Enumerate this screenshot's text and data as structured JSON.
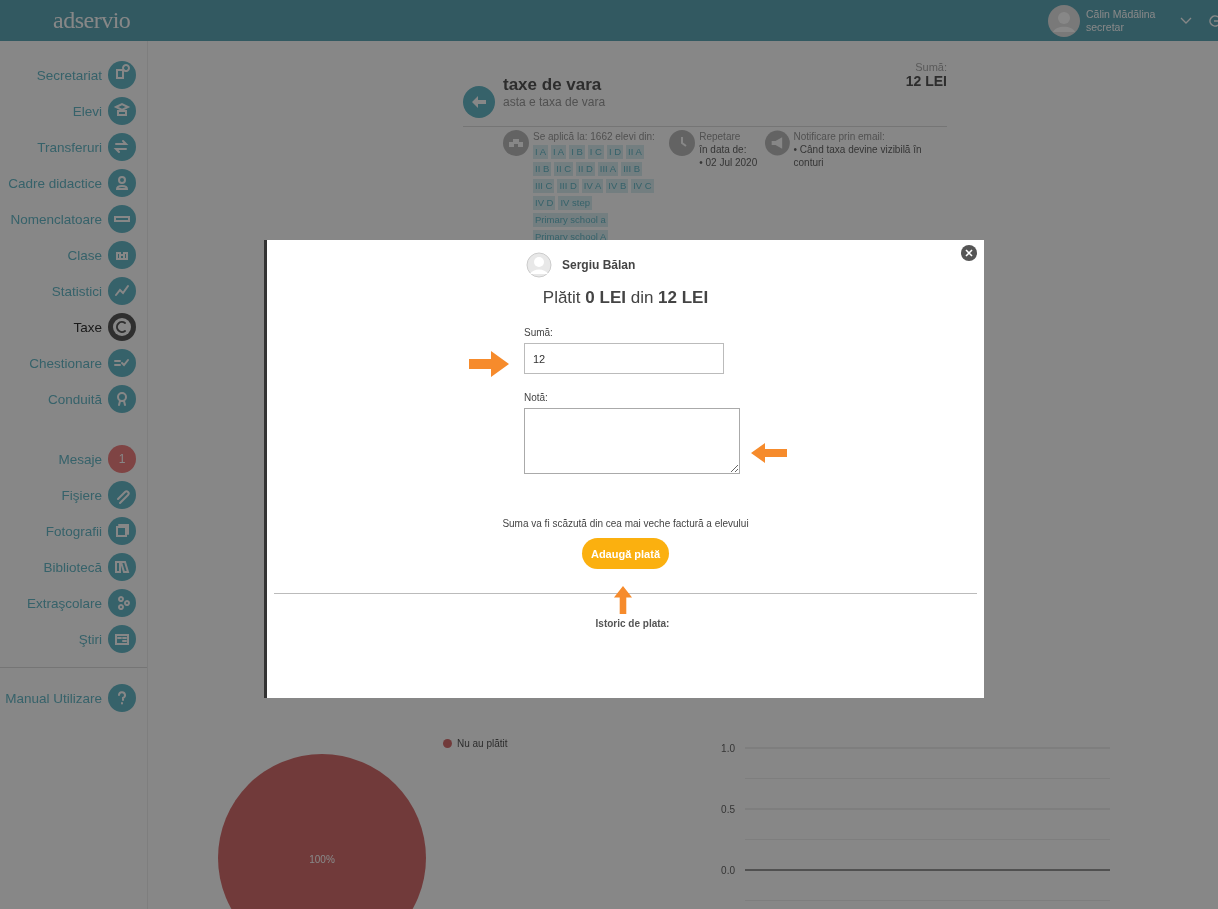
{
  "header": {
    "logo": "adservio",
    "user_name": "Călin Mădălina",
    "user_role": "secretar"
  },
  "sidebar": {
    "sections": [
      {
        "items": [
          {
            "label": "Secretariat",
            "kind": "icon",
            "selected": false
          },
          {
            "label": "Elevi",
            "kind": "icon",
            "selected": false
          },
          {
            "label": "Transferuri",
            "kind": "icon",
            "selected": false
          },
          {
            "label": "Cadre didactice",
            "kind": "icon",
            "selected": false
          },
          {
            "label": "Nomenclatoare",
            "kind": "icon",
            "selected": false
          },
          {
            "label": "Clase",
            "kind": "icon",
            "selected": false
          },
          {
            "label": "Statistici",
            "kind": "icon",
            "selected": false
          },
          {
            "label": "Taxe",
            "kind": "icon",
            "selected": true
          },
          {
            "label": "Chestionare",
            "kind": "icon",
            "selected": false
          },
          {
            "label": "Conduită",
            "kind": "icon",
            "selected": false
          }
        ]
      },
      {
        "items": [
          {
            "label": "Mesaje",
            "kind": "badge",
            "badge": "1",
            "selected": false
          },
          {
            "label": "Fişiere",
            "kind": "icon",
            "selected": false
          },
          {
            "label": "Fotografii",
            "kind": "icon",
            "selected": false
          },
          {
            "label": "Bibliotecă",
            "kind": "icon",
            "selected": false
          },
          {
            "label": "Extraşcolare",
            "kind": "icon",
            "selected": false
          },
          {
            "label": "Ştiri",
            "kind": "icon",
            "selected": false
          }
        ]
      },
      {
        "items": [
          {
            "label": "Manual Utilizare",
            "kind": "icon",
            "selected": false
          }
        ]
      }
    ]
  },
  "fee": {
    "title": "taxe de vara",
    "subtitle": "asta e taxa de vara",
    "amount_label": "Sumă:",
    "amount": "12 LEI",
    "applies_text": "Se aplică la: 1662 elevi din:",
    "classes": [
      "I A",
      "I A",
      "I B",
      "I C",
      "I D",
      "II A",
      "II B",
      "II C",
      "II D",
      "III A",
      "III B",
      "III C",
      "III D",
      "IV A",
      "IV B",
      "IV C",
      "IV D",
      "IV step",
      "Primary school a",
      "Primary school A"
    ],
    "repeat_label": "Repetare",
    "repeat_date_label": "în data de:",
    "repeat_dates": [
      "• 02 Jul 2020"
    ],
    "notify_label": "Notificare prin email:",
    "notify_items": [
      "• Când taxa devine vizibilă în conturi"
    ]
  },
  "charts": {
    "pie": {
      "legend": [
        {
          "label": "Nu au plătit"
        }
      ],
      "slice_label": "100%"
    },
    "line": {
      "y_labels": [
        "1.0",
        "0.5",
        "0.0"
      ]
    }
  },
  "modal": {
    "student_name": "Sergiu Bălan",
    "title": "Plătit **0 LEI** din **12 LEI**",
    "amount_label": "Sumă:",
    "amount_value": "12",
    "note_label": "Notă:",
    "hint": "Suma va fi scăzută din cea mai veche factură a elevului",
    "button": "Adaugă plată",
    "history_label": "Istoric de plata:"
  }
}
